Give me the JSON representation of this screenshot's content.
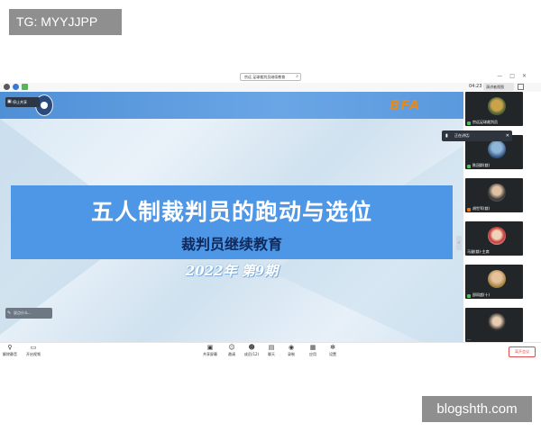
{
  "watermarks": {
    "top": "TG: MYYJJPP",
    "bottom": "blogshth.com"
  },
  "window": {
    "meeting_title": "宗远 足球裁判员继续教育",
    "controls": [
      "—",
      "□",
      "✕"
    ],
    "time": "04:23",
    "view_label": "演讲者视图",
    "search_icon": "search-icon"
  },
  "stage": {
    "share_badge": "停止共享",
    "brand": "BFA",
    "slide_title": "五人制裁判员的跑动与选位",
    "slide_subtitle": "裁判员继续教育",
    "slide_period": "2022年 第9期",
    "chat_placeholder": "说点什么...",
    "colors": {
      "banner": "#5a99dd",
      "title_band": "#4e97e6",
      "brand": "#e58a1f"
    }
  },
  "speaker_popup": "正在讲话:",
  "participants": [
    {
      "name": "宗远足球裁判员"
    },
    {
      "name": "陈冠群(裁)"
    },
    {
      "name": "胡世军(裁)"
    },
    {
      "name": "马骏(裁)-主席"
    },
    {
      "name": "邵同超(十)"
    },
    {
      "name": "…"
    }
  ],
  "toolbar": {
    "items": [
      {
        "label": "解除静音",
        "icon": "mic-icon"
      },
      {
        "label": "开启视频",
        "icon": "camera-icon"
      },
      {
        "label": "共享屏幕",
        "icon": "share-screen-icon"
      },
      {
        "label": "邀请",
        "icon": "invite-icon"
      },
      {
        "label": "成员(12)",
        "icon": "members-icon"
      },
      {
        "label": "聊天",
        "icon": "chat-icon"
      },
      {
        "label": "录制",
        "icon": "record-icon"
      },
      {
        "label": "应用",
        "icon": "apps-icon"
      },
      {
        "label": "设置",
        "icon": "settings-icon"
      }
    ],
    "leave": "离开会议"
  }
}
